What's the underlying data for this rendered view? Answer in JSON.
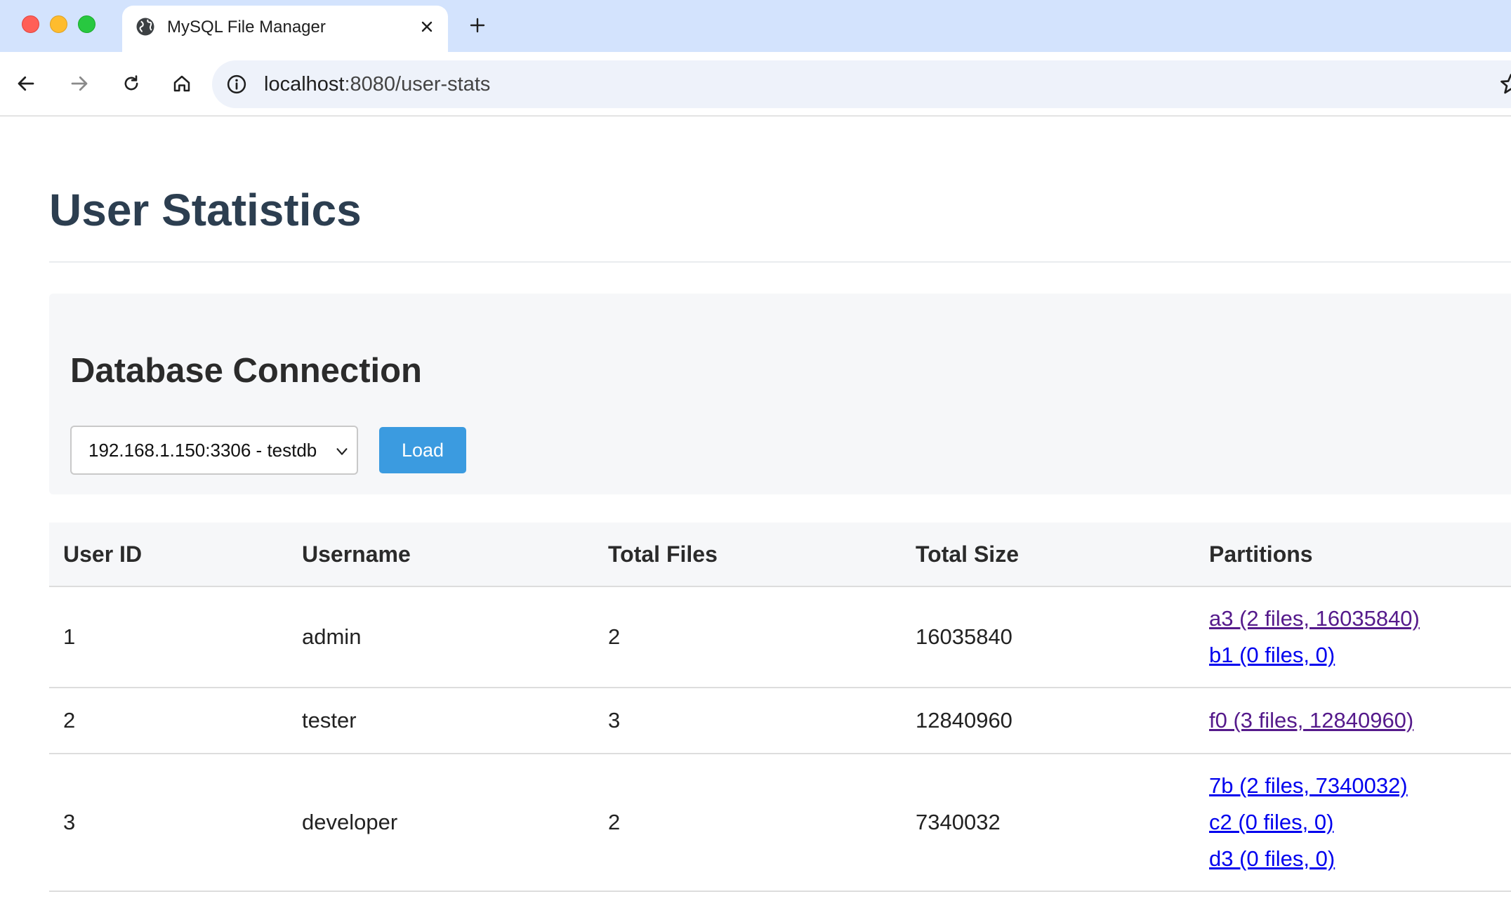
{
  "browser": {
    "tab_title": "MySQL File Manager",
    "url_host": "localhost",
    "url_path": ":8080/user-stats"
  },
  "page": {
    "title": "User Statistics"
  },
  "connection": {
    "heading": "Database Connection",
    "selected_db": "192.168.1.150:3306 - testdb",
    "load_label": "Load"
  },
  "table": {
    "headers": [
      "User ID",
      "Username",
      "Total Files",
      "Total Size",
      "Partitions"
    ],
    "rows": [
      {
        "user_id": "1",
        "username": "admin",
        "total_files": "2",
        "total_size": "16035840",
        "partitions": [
          {
            "label": "a3 (2 files, 16035840)",
            "visited": true
          },
          {
            "label": "b1 (0 files, 0)",
            "visited": false
          }
        ]
      },
      {
        "user_id": "2",
        "username": "tester",
        "total_files": "3",
        "total_size": "12840960",
        "partitions": [
          {
            "label": "f0 (3 files, 12840960)",
            "visited": true
          }
        ]
      },
      {
        "user_id": "3",
        "username": "developer",
        "total_files": "2",
        "total_size": "7340032",
        "partitions": [
          {
            "label": "7b (2 files, 7340032)",
            "visited": false
          },
          {
            "label": "c2 (0 files, 0)",
            "visited": false
          },
          {
            "label": "d3 (0 files, 0)",
            "visited": false
          }
        ]
      }
    ]
  },
  "colors": {
    "title": "#2c3e50",
    "button": "#3b9be0",
    "link": "#0000ee",
    "link_visited": "#551a8b",
    "tabbar": "#d3e3fd"
  }
}
